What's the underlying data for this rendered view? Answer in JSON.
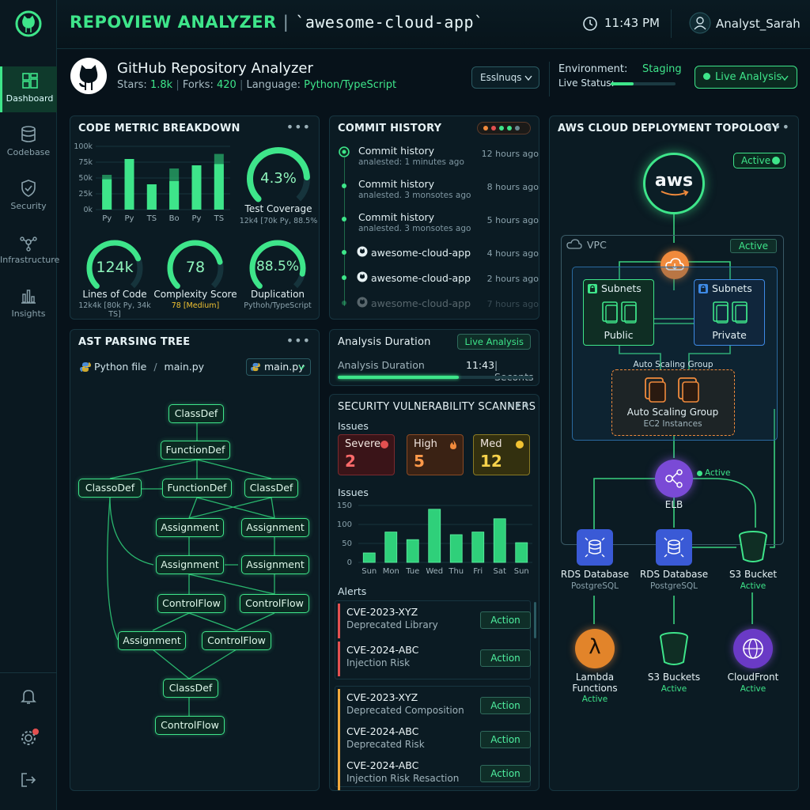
{
  "header": {
    "app_name": "REPOVIEW ANALYZER",
    "separator": "|",
    "repo": "`awesome-cloud-app`",
    "time": "11:43 PM",
    "user": "Analyst_Sarah"
  },
  "sidebar": {
    "items": [
      {
        "label": "Dashboard",
        "icon": "dashboard-icon",
        "active": true
      },
      {
        "label": "Codebase",
        "icon": "database-icon"
      },
      {
        "label": "Security",
        "icon": "shield-icon"
      },
      {
        "label": "Infrastructure",
        "icon": "network-icon"
      },
      {
        "label": "Insights",
        "icon": "bar-chart-icon"
      }
    ]
  },
  "repo": {
    "title": "GitHub Repository Analyzer",
    "stars_label": "Stars:",
    "stars": "1.8k",
    "forks_label": "Forks:",
    "forks": "420",
    "language_label": "Language:",
    "language": "Python/TypeScript",
    "settings_button": "Esslnuqs",
    "env_label": "Environment:",
    "env_value": "Staging",
    "live_status_label": "Live Status:",
    "live_status_progress": 0.35,
    "live_button": "Live Analysis"
  },
  "code_metrics": {
    "title": "CODE METRIC BREAKDOWN",
    "menu": "•••",
    "gauges": {
      "test_coverage": {
        "value": "4.3%",
        "label": "Test Coverage",
        "sub": "12k4 [70k Py, 88.5%",
        "fraction": 0.82
      },
      "lines_of_code": {
        "value": "124k",
        "label": "Lines of Code",
        "sub": "12k4k [80k Py, 34k TS]",
        "fraction": 0.75
      },
      "complexity": {
        "value": "78",
        "label": "Complexity Score",
        "sub": "78 [Medium]",
        "fraction": 0.78
      },
      "duplication": {
        "value": "88.5%",
        "label": "Duplication",
        "sub": "Pythoh/TypeScript",
        "fraction": 0.88
      }
    }
  },
  "chart_data": [
    {
      "type": "bar",
      "categories": [
        "Py",
        "Py",
        "TS",
        "Bo",
        "Py",
        "TS"
      ],
      "series": [
        {
          "values": [
            55,
            80,
            40,
            65,
            70,
            88
          ]
        },
        {
          "values": [
            48,
            0,
            0,
            45,
            0,
            72
          ]
        }
      ],
      "yticks": [
        "100k",
        "75k",
        "50k",
        "25k",
        "0k"
      ],
      "ylim": [
        0,
        100
      ]
    },
    {
      "type": "bar",
      "categories": [
        "Sun",
        "Mon",
        "Tue",
        "Wed",
        "Thu",
        "Fri",
        "Sat",
        "Sun"
      ],
      "values": [
        25,
        80,
        60,
        140,
        73,
        80,
        115,
        52
      ],
      "yticks": [
        "150",
        "100",
        "50",
        "0"
      ],
      "ylim": [
        0,
        150
      ]
    }
  ],
  "commit_history": {
    "title": "COMMIT HISTORY",
    "items": [
      {
        "title": "Commit history",
        "sub": "analested: 1 minutes ago",
        "time": "12 hours ago"
      },
      {
        "title": "Commit history",
        "sub": "analested. 3 monsotes ago",
        "time": "8 hours ago"
      },
      {
        "title": "Commit history",
        "sub": "analested. 3 monsotes ago",
        "time": "5 hours ago"
      },
      {
        "title": "awesome-cloud-app",
        "sub": "",
        "time": "4 hours ago"
      },
      {
        "title": "awesome-cloud-app",
        "sub": "",
        "time": "2 hours ago"
      },
      {
        "title": "awesome-cloud-app",
        "sub": "",
        "time": "7 hours ago"
      }
    ]
  },
  "analysis": {
    "title": "Analysis Duration",
    "badge": "Live Analysis",
    "label": "Analysis Duration",
    "time": "11:43",
    "unit": "| Seconts",
    "progress": 0.62
  },
  "ast": {
    "title": "AST PARSING TREE",
    "menu": "•••",
    "file_label": "Python file",
    "path_sep": "/",
    "file_name": "main.py",
    "dropdown": "main.py",
    "nodes": [
      "ClassDef",
      "FunctionDef",
      "ClassoDef",
      "FunctionDef",
      "ClassDef",
      "Assignment",
      "Assignment",
      "Assignment",
      "Assignment",
      "ControlFlow",
      "ControlFlow",
      "Assignment",
      "ControlFlow",
      "ClassDef",
      "ControlFlow"
    ]
  },
  "security": {
    "title": "SECURITY VULNERABILITY SCANNERS",
    "menu": "•••",
    "issues_label": "Issues",
    "severe": {
      "label": "Severe",
      "value": "2"
    },
    "high": {
      "label": "High",
      "value": "5"
    },
    "med": {
      "label": "Med",
      "value": "12"
    },
    "issues_chart_label": "Issues",
    "alerts_label": "Alerts",
    "alerts": [
      {
        "id": "CVE-2023-XYZ",
        "desc": "Deprecated Library",
        "action": "Action"
      },
      {
        "id": "CVE-2024-ABC",
        "desc": "Injection Risk",
        "action": "Action"
      },
      {
        "id": "CVE-2023-XYZ",
        "desc": "Deprecated Composition",
        "action": "Action"
      },
      {
        "id": "CVE-2024-ABC",
        "desc": "Deprecated Risk",
        "action": "Action"
      },
      {
        "id": "CVE-2024-ABC",
        "desc": "Injection Risk Resaction",
        "action": "Action"
      }
    ]
  },
  "aws": {
    "title": "AWS CLOUD DEPLOYMENT TOPOLOGY",
    "menu": "•••",
    "active_badge": "Active",
    "aws_logo": "aws",
    "vpc_label": "VPC",
    "vpc_active": "Active",
    "subnet_public_title": "Subnets",
    "subnet_public_label": "Public",
    "subnet_private_title": "Subnets",
    "subnet_private_label": "Private",
    "asg_header": "Auto Scaling Group",
    "asg_label": "Auto Scaling Group",
    "asg_sub": "EC2 Instances",
    "elb_label": "ELB",
    "elb_active": "Active",
    "rds1_label": "RDS Database",
    "rds1_sub": "PostgreSQL",
    "rds2_label": "RDS Database",
    "rds2_sub": "PostgreSQL",
    "s3_label": "S3 Bucket",
    "s3_active": "Active",
    "lambda_label": "Lambda",
    "lambda_label2": "Functions",
    "lambda_active": "Active",
    "s3b_label": "S3 Buckets",
    "s3b_active": "Active",
    "cf_label": "CloudFront",
    "cf_active": "Active"
  },
  "colors": {
    "accent": "#3ee58a",
    "severe": "#e25050",
    "high": "#f08a3c",
    "med": "#f1c232",
    "bg": "#07121a"
  }
}
